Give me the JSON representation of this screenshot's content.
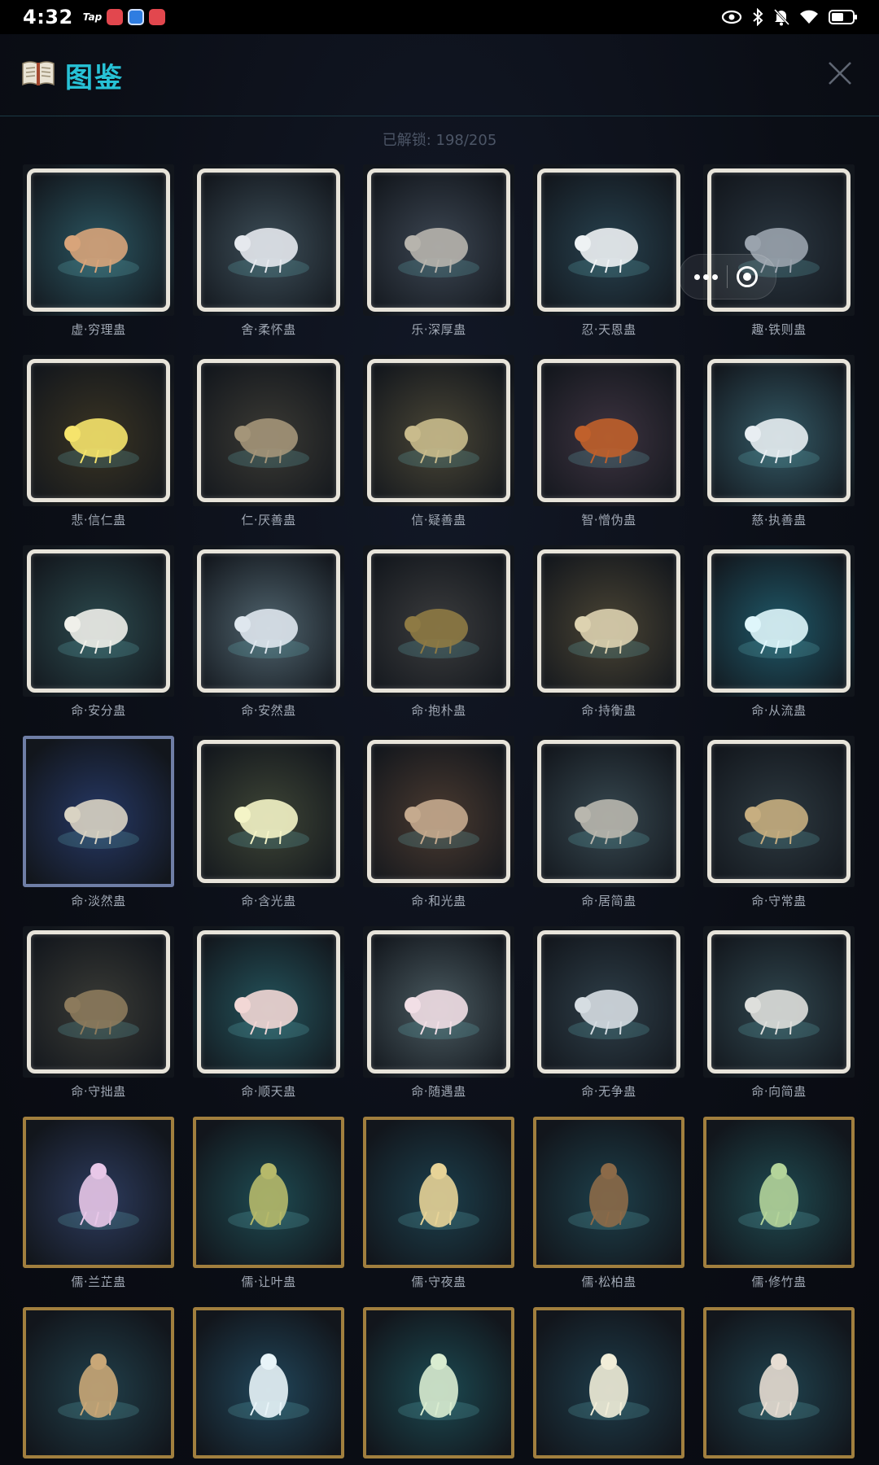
{
  "status_bar": {
    "time": "4:32",
    "app_label": "Tap",
    "icons": [
      "eye-icon",
      "bluetooth-icon",
      "bell-off-icon",
      "wifi-icon",
      "battery-icon"
    ]
  },
  "header": {
    "title": "图鉴",
    "icon": "book-icon",
    "close_icon": "close-icon",
    "accent_color": "#27c2d6"
  },
  "counter": {
    "text": "已解锁: 198/205"
  },
  "cards": [
    {
      "name": "虚·穷理蛊",
      "tier": "bone",
      "bg": "#2b5560",
      "creature": "#d8a47a"
    },
    {
      "name": "舍·柔怀蛊",
      "tier": "bone",
      "bg": "#3d4e58",
      "creature": "#e6e9ee"
    },
    {
      "name": "乐·深厚蛊",
      "tier": "bone",
      "bg": "#3c4652",
      "creature": "#b7b4ad"
    },
    {
      "name": "忍·天恩蛊",
      "tier": "bone",
      "bg": "#27414e",
      "creature": "#eef2f4"
    },
    {
      "name": "趣·铁则蛊",
      "tier": "bone",
      "bg": "#2a3640",
      "creature": "#9aa3ad"
    },
    {
      "name": "悲·信仁蛊",
      "tier": "bone",
      "bg": "#3a3423",
      "creature": "#f6e46c"
    },
    {
      "name": "仁·厌善蛊",
      "tier": "bone",
      "bg": "#3b3a34",
      "creature": "#a49579"
    },
    {
      "name": "信·疑善蛊",
      "tier": "bone",
      "bg": "#4a4636",
      "creature": "#c9bb8c"
    },
    {
      "name": "智·憎伪蛊",
      "tier": "bone",
      "bg": "#3d3340",
      "creature": "#c0602b"
    },
    {
      "name": "慈·执善蛊",
      "tier": "bone",
      "bg": "#345a66",
      "creature": "#e8eef2"
    },
    {
      "name": "命·安分蛊",
      "tier": "bone",
      "bg": "#2c4a4e",
      "creature": "#f0f0ea"
    },
    {
      "name": "命·安然蛊",
      "tier": "bone",
      "bg": "#50646e",
      "creature": "#dfe7ee"
    },
    {
      "name": "命·抱朴蛊",
      "tier": "bone",
      "bg": "#3b3c3d",
      "creature": "#8e7a44"
    },
    {
      "name": "命·持衡蛊",
      "tier": "bone",
      "bg": "#4a4434",
      "creature": "#ddd2b0"
    },
    {
      "name": "命·从流蛊",
      "tier": "bone",
      "bg": "#1f5868",
      "creature": "#dff6fb"
    },
    {
      "name": "命·淡然蛊",
      "tier": "blue",
      "bg": "#263865",
      "creature": "#d9d3c3"
    },
    {
      "name": "命·含光蛊",
      "tier": "bone",
      "bg": "#3e4536",
      "creature": "#f4f4c7"
    },
    {
      "name": "命·和光蛊",
      "tier": "bone",
      "bg": "#4a3a30",
      "creature": "#c5aa8e"
    },
    {
      "name": "命·居简蛊",
      "tier": "bone",
      "bg": "#374850",
      "creature": "#b9b7ae"
    },
    {
      "name": "命·守常蛊",
      "tier": "bone",
      "bg": "#2d3940",
      "creature": "#c7ae80"
    },
    {
      "name": "命·守拙蛊",
      "tier": "bone",
      "bg": "#3a3b36",
      "creature": "#8c7a5c"
    },
    {
      "name": "命·顺天蛊",
      "tier": "bone",
      "bg": "#24535b",
      "creature": "#f2d7d5"
    },
    {
      "name": "命·随遇蛊",
      "tier": "bone",
      "bg": "#4a5a60",
      "creature": "#f2dfe6"
    },
    {
      "name": "命·无争蛊",
      "tier": "bone",
      "bg": "#2e3e48",
      "creature": "#d6dde2"
    },
    {
      "name": "命·向简蛊",
      "tier": "bone",
      "bg": "#30464e",
      "creature": "#dedfdc"
    },
    {
      "name": "儒·兰芷蛊",
      "tier": "gold",
      "bg": "#2d3b5e",
      "creature": "#e8c7e8"
    },
    {
      "name": "儒·让叶蛊",
      "tier": "gold",
      "bg": "#1e4b52",
      "creature": "#b6b96a"
    },
    {
      "name": "儒·守夜蛊",
      "tier": "gold",
      "bg": "#1c3f4c",
      "creature": "#e7d397"
    },
    {
      "name": "儒·松柏蛊",
      "tier": "gold",
      "bg": "#1d3f4a",
      "creature": "#8c6a48"
    },
    {
      "name": "儒·修竹蛊",
      "tier": "gold",
      "bg": "#1f4a50",
      "creature": "#b4d49a"
    },
    {
      "name": "",
      "tier": "gold",
      "bg": "#213f4a",
      "creature": "#c9a777"
    },
    {
      "name": "",
      "tier": "gold",
      "bg": "#21465a",
      "creature": "#e8f4f8"
    },
    {
      "name": "",
      "tier": "gold",
      "bg": "#1c4a52",
      "creature": "#d9ecd0"
    },
    {
      "name": "",
      "tier": "gold",
      "bg": "#1e3c4a",
      "creature": "#f1edd8"
    },
    {
      "name": "",
      "tier": "gold",
      "bg": "#20424e",
      "creature": "#e7ddd2"
    }
  ]
}
